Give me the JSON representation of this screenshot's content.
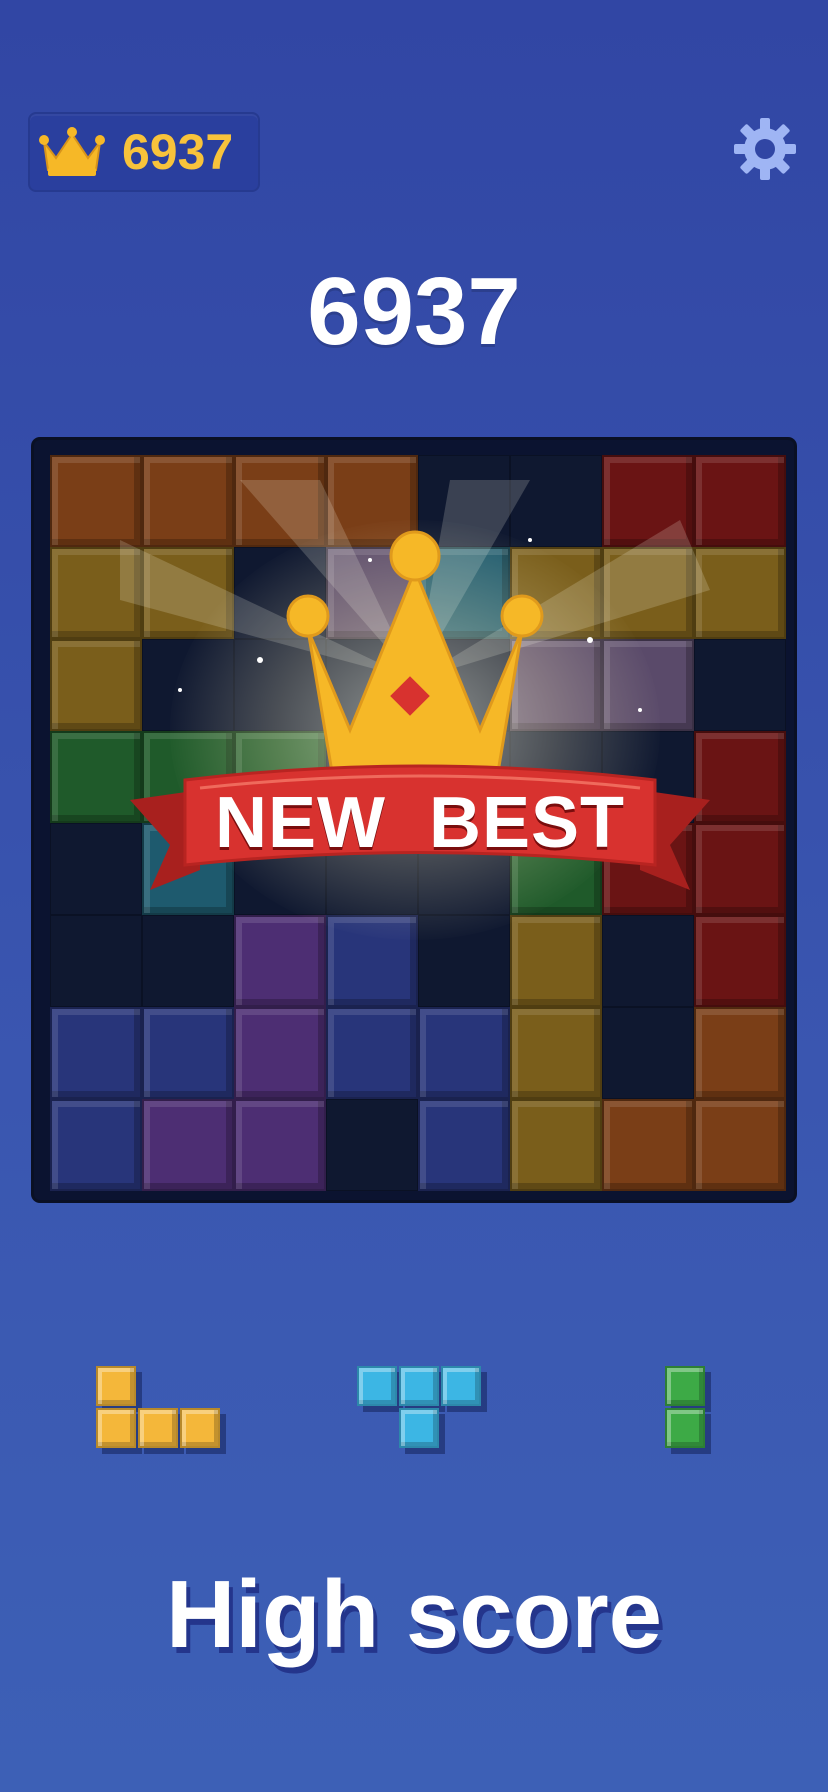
{
  "header": {
    "best_score": "6937",
    "icons": {
      "best": "crown-icon",
      "settings": "gear-icon"
    }
  },
  "score": "6937",
  "celebration": {
    "banner_text": "NEW BEST",
    "icon": "crown-icon"
  },
  "colors": {
    "O": "#7a3e17",
    "Y": "#7a5e1b",
    "R": "#6a1414",
    "G": "#1f5a2a",
    "B": "#28357a",
    "P": "#4d2e73",
    "C": "#1e5a6e",
    "L": "#5a4a6a",
    "yellow_piece": "#f4b73a",
    "cyan_piece": "#3cb6e4",
    "green_piece": "#3daa46",
    "banner_red": "#d8322f",
    "crown_gold": "#f6b827"
  },
  "board": {
    "rows": [
      [
        "O",
        "O",
        "O",
        "O",
        ".",
        ".",
        "R",
        "R"
      ],
      [
        "Y",
        "Y",
        ".",
        "L",
        "C",
        "Y",
        "Y",
        "Y"
      ],
      [
        "Y",
        ".",
        ".",
        ".",
        ".",
        "L",
        "L",
        "."
      ],
      [
        "G",
        "G",
        "G",
        ".",
        ".",
        ".",
        ".",
        "R"
      ],
      [
        ".",
        "C",
        ".",
        ".",
        ".",
        "G",
        "R",
        "R"
      ],
      [
        ".",
        ".",
        "P",
        "B",
        ".",
        "Y",
        ".",
        "R"
      ],
      [
        "B",
        "B",
        "P",
        "B",
        "B",
        "Y",
        ".",
        "O"
      ],
      [
        "B",
        "P",
        "P",
        ".",
        "B",
        "Y",
        "O",
        "O"
      ]
    ]
  },
  "tray": {
    "pieces": [
      {
        "name": "yellow-l-piece",
        "color": "yellow_piece",
        "cells": [
          [
            0,
            0
          ],
          [
            0,
            1
          ],
          [
            1,
            1
          ],
          [
            2,
            1
          ]
        ]
      },
      {
        "name": "cyan-t-piece",
        "color": "cyan_piece",
        "cells": [
          [
            0,
            0
          ],
          [
            1,
            0
          ],
          [
            2,
            0
          ],
          [
            1,
            1
          ]
        ]
      },
      {
        "name": "green-i-piece",
        "color": "green_piece",
        "cells": [
          [
            0,
            0
          ],
          [
            0,
            1
          ]
        ]
      }
    ]
  },
  "caption": "High score"
}
